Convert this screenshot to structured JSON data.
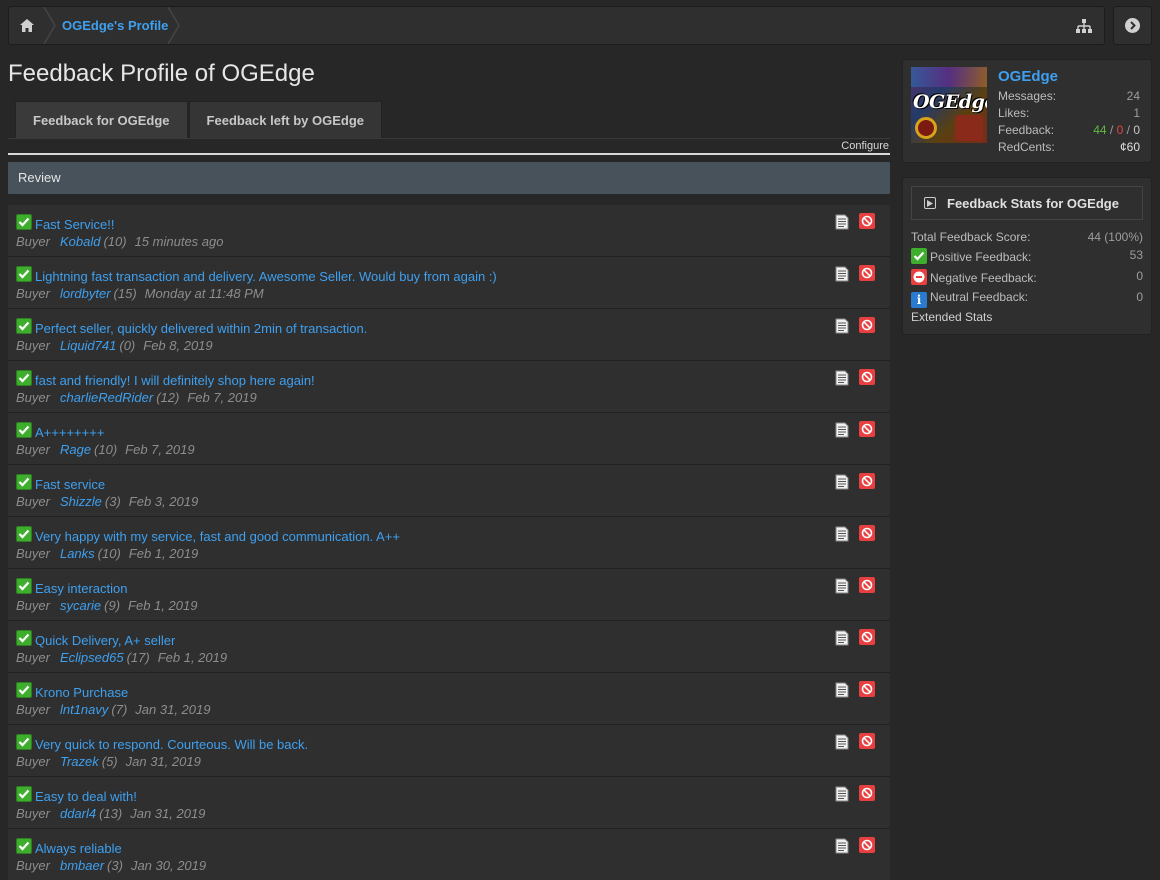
{
  "breadcrumb": {
    "home_icon": "home-icon",
    "profile_link": "OGEdge's Profile",
    "sitemap_icon": "sitemap-icon",
    "next_icon": "arrow-right-circle-icon"
  },
  "page": {
    "title": "Feedback Profile of OGEdge"
  },
  "tabs": [
    {
      "label": "Feedback for OGEdge",
      "active": true
    },
    {
      "label": "Feedback left by OGEdge",
      "active": false
    }
  ],
  "configure_label": "Configure",
  "review_header": "Review",
  "feedback": [
    {
      "text": "Fast Service!!",
      "role": "Buyer",
      "user": "Kobald",
      "count": "(10)",
      "date": "15 minutes ago"
    },
    {
      "text": "Lightning fast transaction and delivery. Awesome Seller. Would buy from again :)",
      "role": "Buyer",
      "user": "lordbyter",
      "count": "(15)",
      "date": "Monday at 11:48 PM"
    },
    {
      "text": "Perfect seller, quickly delivered within 2min of transaction.",
      "role": "Buyer",
      "user": "Liquid741",
      "count": "(0)",
      "date": "Feb 8, 2019"
    },
    {
      "text": "fast and friendly! I will definitely shop here again!",
      "role": "Buyer",
      "user": "charlieRedRider",
      "count": "(12)",
      "date": "Feb 7, 2019"
    },
    {
      "text": "A++++++++",
      "role": "Buyer",
      "user": "Rage",
      "count": "(10)",
      "date": "Feb 7, 2019"
    },
    {
      "text": "Fast service",
      "role": "Buyer",
      "user": "Shizzle",
      "count": "(3)",
      "date": "Feb 3, 2019"
    },
    {
      "text": "Very happy with my service, fast and good communication. A++",
      "role": "Buyer",
      "user": "Lanks",
      "count": "(10)",
      "date": "Feb 1, 2019"
    },
    {
      "text": "Easy interaction",
      "role": "Buyer",
      "user": "sycarie",
      "count": "(9)",
      "date": "Feb 1, 2019"
    },
    {
      "text": "Quick Delivery, A+ seller",
      "role": "Buyer",
      "user": "Eclipsed65",
      "count": "(17)",
      "date": "Feb 1, 2019"
    },
    {
      "text": "Krono Purchase",
      "role": "Buyer",
      "user": "lnt1navy",
      "count": "(7)",
      "date": "Jan 31, 2019"
    },
    {
      "text": "Very quick to respond. Courteous. Will be back.",
      "role": "Buyer",
      "user": "Trazek",
      "count": "(5)",
      "date": "Jan 31, 2019"
    },
    {
      "text": "Easy to deal with!",
      "role": "Buyer",
      "user": "ddarl4",
      "count": "(13)",
      "date": "Jan 31, 2019"
    },
    {
      "text": "Always reliable",
      "role": "Buyer",
      "user": "bmbaer",
      "count": "(3)",
      "date": "Jan 30, 2019"
    }
  ],
  "profile": {
    "name": "OGEdge",
    "avatar_text": "OGEdge",
    "messages_label": "Messages:",
    "messages_value": "24",
    "likes_label": "Likes:",
    "likes_value": "1",
    "feedback_label": "Feedback:",
    "feedback_pos": "44",
    "feedback_neg": "0",
    "feedback_neu": "0",
    "feedback_sep": " / ",
    "redcents_label": "RedCents:",
    "redcents_value": "¢60"
  },
  "stats": {
    "title": "Feedback Stats for OGEdge",
    "total_label": "Total Feedback Score:",
    "total_value": "44 (100%)",
    "positive_label": "Positive Feedback:",
    "positive_value": "53",
    "negative_label": "Negative Feedback:",
    "negative_value": "0",
    "neutral_label": "Neutral Feedback:",
    "neutral_value": "0",
    "extended_label": "Extended Stats"
  },
  "colors": {
    "link": "#3ea0f0",
    "positive": "#3fae2e",
    "negative": "#e84040",
    "neutral": "#2a7ad0",
    "header_bar": "#47525a"
  }
}
